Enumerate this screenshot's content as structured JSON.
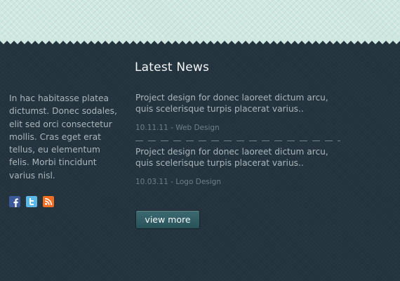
{
  "about": {
    "text": "In hac habitasse platea dictumst. Donec sodales, elit sed orci consectetur mollis. Cras eget erat tellus, eu elementum felis. Morbi tincidunt varius nisl."
  },
  "social": {
    "icons": [
      "facebook-icon",
      "twitter-icon",
      "rss-icon"
    ],
    "colors": {
      "facebook": "#3b5998",
      "twitter": "#5bb8e6",
      "rss": "#f26e21"
    }
  },
  "news": {
    "title": "Latest News",
    "items": [
      {
        "headline": "Project design for donec laoreet dictum arcu, quis scelerisque turpis placerat varius..",
        "meta": "10.11.11 - Web Design"
      },
      {
        "headline": "Project design for donec laoreet dictum arcu, quis scelerisque turpis placerat varius..",
        "meta": "10.03.11 - Logo Design"
      }
    ],
    "view_more_label": "view more"
  },
  "colors": {
    "background": "#24343f",
    "top_band": "#cfe7e1",
    "button": "#2f5c63",
    "heading": "#f2f6f6",
    "body_text": "#a9b7bb",
    "meta_text": "#6d7f86"
  }
}
